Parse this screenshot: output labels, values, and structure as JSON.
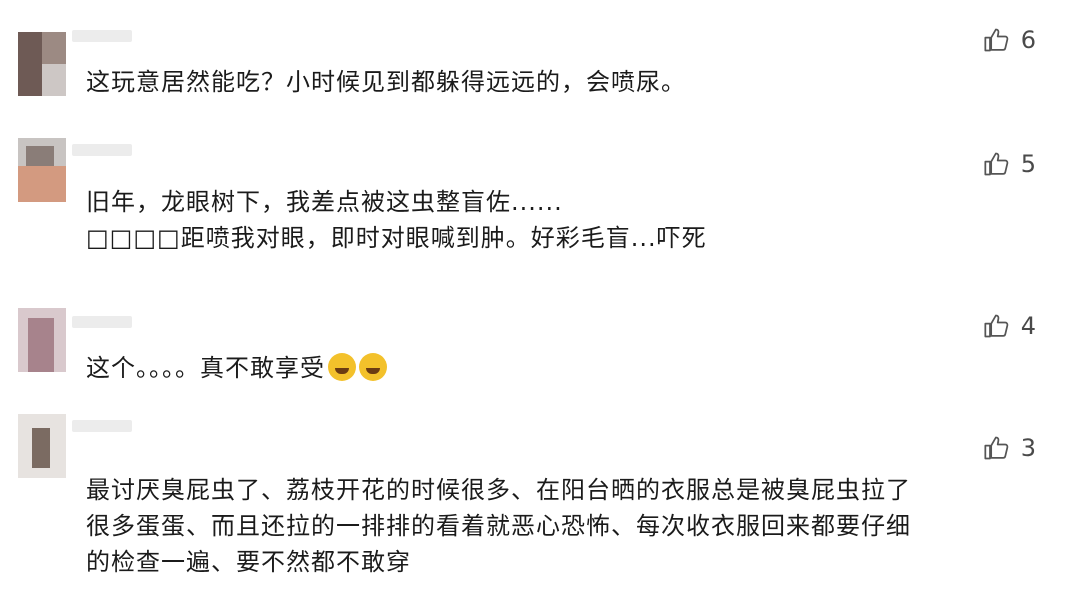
{
  "comments": [
    {
      "likes": "6",
      "lines": [
        "这玩意居然能吃？小时候见到都躲得远远的，会喷尿。"
      ]
    },
    {
      "likes": "5",
      "lines": [
        "旧年，龙眼树下，我差点被这虫整盲佐......",
        "□□□□距喷我对眼，即时对眼喊到肿。好彩毛盲...吓死"
      ]
    },
    {
      "likes": "4",
      "lines": [
        "这个。。。。真不敢享受"
      ],
      "emojis": [
        "rolling-laughing-emoji",
        "tears-of-joy-emoji"
      ]
    },
    {
      "likes": "3",
      "lines": [
        "最讨厌臭屁虫了、荔枝开花的时候很多、在阳台晒的衣服总是被臭屁虫拉了",
        "很多蛋蛋、而且还拉的一排排的看着就恶心恐怖、每次收衣服回来都要仔细",
        "的检查一遍、要不然都不敢穿"
      ]
    }
  ]
}
